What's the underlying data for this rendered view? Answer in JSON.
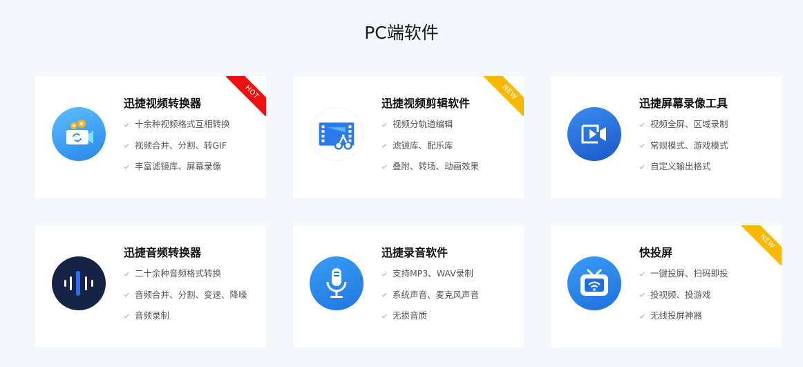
{
  "section": {
    "title": "PC端软件"
  },
  "colors": {
    "hot": "#ee1111",
    "new": "#fbb800",
    "check": "#b8b8b8"
  },
  "cards": [
    {
      "title": "迅捷视频转换器",
      "badge": "HOT",
      "icon": "video-converter-icon",
      "features": [
        "十余种视频格式互相转换",
        "视频合并、分割、转GIF",
        "丰富滤镜库、屏幕录像"
      ]
    },
    {
      "title": "迅捷视频剪辑软件",
      "badge": "NEW",
      "icon": "video-editor-icon",
      "features": [
        "视频分轨道编辑",
        "滤镜库、配乐库",
        "叠附、转场、动画效果"
      ]
    },
    {
      "title": "迅捷屏幕录像工具",
      "badge": "",
      "icon": "screen-recorder-icon",
      "features": [
        "视频全屏、区域录制",
        "常规模式、游戏模式",
        "自定义输出格式"
      ]
    },
    {
      "title": "迅捷音频转换器",
      "badge": "",
      "icon": "audio-converter-icon",
      "features": [
        "二十余种音频格式转换",
        "音频合并、分割、变速、降噪",
        "音频录制"
      ]
    },
    {
      "title": "迅捷录音软件",
      "badge": "",
      "icon": "microphone-icon",
      "features": [
        "支持MP3、WAV录制",
        "系统声音、麦克风声音",
        "无损音质"
      ]
    },
    {
      "title": "快投屏",
      "badge": "NEW",
      "icon": "screen-cast-icon",
      "features": [
        "一键投屏、扫码即投",
        "投视频、投游戏",
        "无线投屏神器"
      ]
    }
  ]
}
